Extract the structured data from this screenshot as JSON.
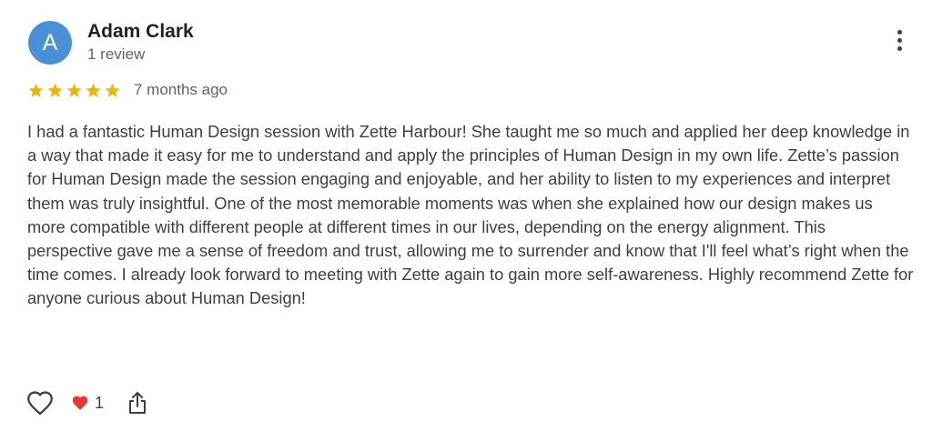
{
  "reviewer": {
    "avatar_letter": "A",
    "name": "Adam Clark",
    "review_count": "1 review",
    "avatar_color": "#4a90d9"
  },
  "rating": {
    "stars": 5,
    "max_stars": 5,
    "star_color": "#f4b400",
    "time_ago": "7 months ago"
  },
  "review_text": "I had a fantastic Human Design session with Zette Harbour! She taught me so much and applied her deep knowledge in a way that made it easy for me to understand and apply the principles of Human Design in my own life. Zette’s passion for Human Design made the session engaging and enjoyable, and her ability to listen to my experiences and interpret them was truly insightful. One of the most memorable moments was when she explained how our design makes us more compatible with different people at different times in our lives, depending on the energy alignment. This perspective gave me a sense of freedom and trust, allowing me to surrender and know that I'll feel what’s right when the time comes. I already look forward to meeting with Zette again to gain more self-awareness. Highly recommend Zette for anyone curious about Human Design!",
  "actions": {
    "like_icon": "heart-outline-icon",
    "reaction_icon": "red-heart-icon",
    "reaction_count": "1",
    "share_icon": "share-icon"
  },
  "menu_icon": "more-vert-icon"
}
